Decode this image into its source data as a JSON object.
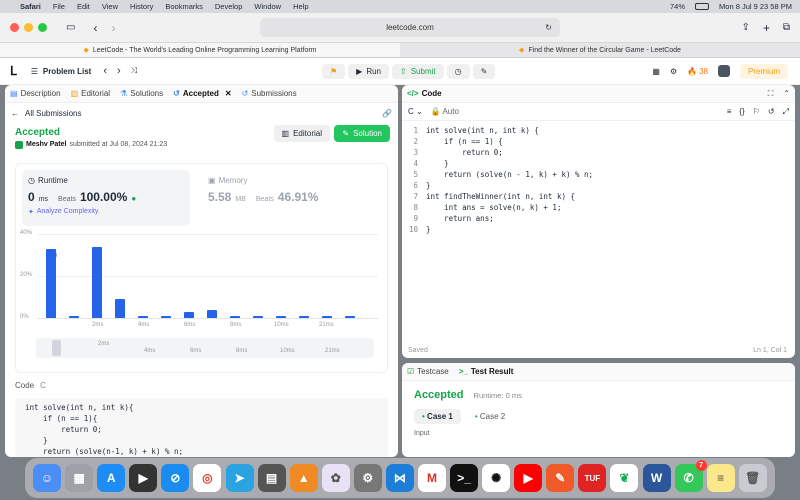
{
  "menubar": {
    "apple": "",
    "app": "Safari",
    "items": [
      "File",
      "Edit",
      "View",
      "History",
      "Bookmarks",
      "Develop",
      "Window",
      "Help"
    ],
    "battery": "74%",
    "clock": "Mon 8 Jul 9 23 58 PM"
  },
  "browser": {
    "url": "leetcode.com",
    "tabs": [
      "LeetCode - The World's Leading Online Programming Learning Platform",
      "Find the Winner of the Circular Game - LeetCode"
    ]
  },
  "lc_top": {
    "problem_list": "Problem List",
    "run": "Run",
    "submit": "Submit",
    "streak": "38",
    "premium": "Premium"
  },
  "left": {
    "tabs": [
      {
        "label": "Description"
      },
      {
        "label": "Editorial"
      },
      {
        "label": "Solutions"
      },
      {
        "label": "Accepted"
      },
      {
        "label": "Submissions"
      }
    ],
    "all_submissions": "All Submissions",
    "status": "Accepted",
    "author": "Meshv Patel",
    "submitted": "submitted at Jul 08, 2024 21:23",
    "editorial_btn": "Editorial",
    "solution_btn": "Solution",
    "runtime": {
      "title": "Runtime",
      "value": "0",
      "unit": "ms",
      "beats_label": "Beats",
      "beats": "100.00%",
      "analyze": "Analyze Complexity"
    },
    "memory": {
      "title": "Memory",
      "value": "5.58",
      "unit": "MB",
      "beats_label": "Beats",
      "beats": "46.91%"
    },
    "code_label": "Code",
    "lang": "C",
    "code": [
      "int solve(int n, int k){",
      "    if (n == 1){",
      "        return 0;",
      "    }",
      "    return (solve(n-1, k) + k) % n;"
    ]
  },
  "chart_data": {
    "type": "bar",
    "ylabel": "",
    "yticks": [
      "40%",
      "20%",
      "0%"
    ],
    "ylim": [
      0,
      40
    ],
    "xticks": [
      "2ms",
      "4ms",
      "6ms",
      "8ms",
      "10ms",
      "21ms"
    ],
    "values": [
      33,
      1,
      34,
      9,
      1,
      1,
      3,
      4,
      1,
      1,
      1,
      1,
      1,
      1
    ]
  },
  "right": {
    "title": "Code",
    "lang": "C",
    "auto": "Auto",
    "code": [
      "int solve(int n, int k) {",
      "    if (n == 1) {",
      "        return 0;",
      "    }",
      "    return (solve(n - 1, k) + k) % n;",
      "}",
      "int findTheWinner(int n, int k) {",
      "    int ans = solve(n, k) + 1;",
      "    return ans;",
      "}"
    ],
    "saved": "Saved",
    "position": "Ln 1, Col 1"
  },
  "bottom": {
    "testcase": "Testcase",
    "test_result": "Test Result",
    "status": "Accepted",
    "runtime": "Runtime: 0 ms",
    "case1": "Case 1",
    "case2": "Case 2",
    "input": "Input"
  },
  "dock": {
    "badge": "7"
  }
}
